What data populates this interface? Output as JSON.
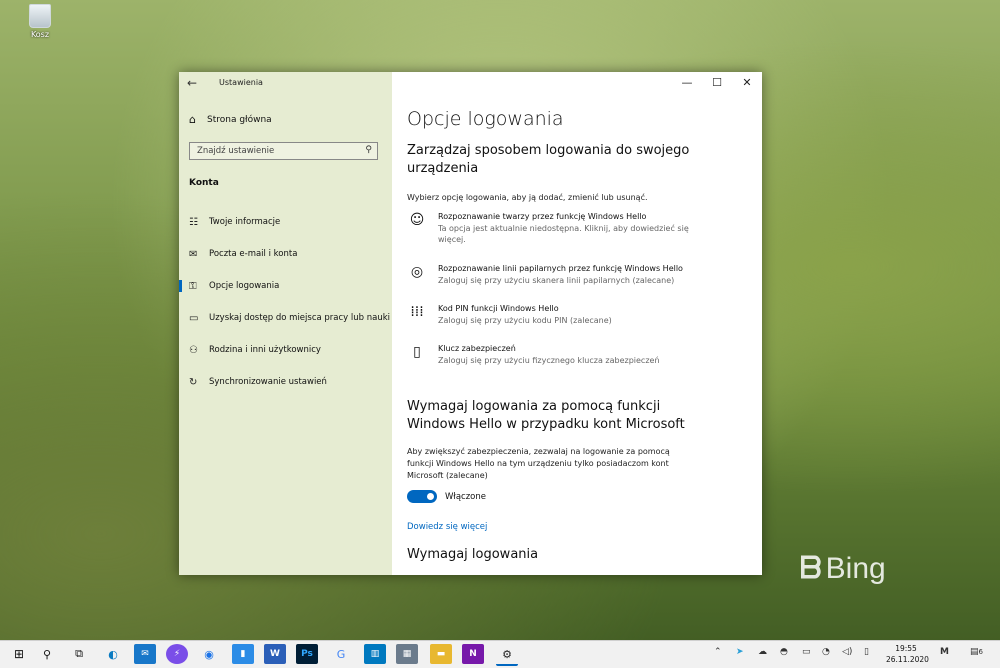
{
  "desktop": {
    "recycle_bin_label": "Kosz",
    "watermark": "Bing"
  },
  "window": {
    "app_title": "Ustawienia",
    "controls": {
      "minimize": "—",
      "maximize": "☐",
      "close": "✕"
    }
  },
  "sidebar": {
    "home_label": "Strona główna",
    "search_placeholder": "Znajdź ustawienie",
    "section": "Konta",
    "items": [
      {
        "label": "Twoje informacje",
        "icon": "person-card-icon"
      },
      {
        "label": "Poczta e-mail i konta",
        "icon": "mail-icon"
      },
      {
        "label": "Opcje logowania",
        "icon": "key-icon"
      },
      {
        "label": "Uzyskaj dostęp do miejsca pracy lub nauki",
        "icon": "briefcase-icon"
      },
      {
        "label": "Rodzina i inni użytkownicy",
        "icon": "people-icon"
      },
      {
        "label": "Synchronizowanie ustawień",
        "icon": "sync-icon"
      }
    ]
  },
  "content": {
    "title": "Opcje logowania",
    "manage_heading": "Zarządzaj sposobem logowania do swojego urządzenia",
    "manage_desc": "Wybierz opcję logowania, aby ją dodać, zmienić lub usunąć.",
    "options": [
      {
        "title": "Rozpoznawanie twarzy przez funkcję Windows Hello",
        "sub": "Ta opcja jest aktualnie niedostępna. Kliknij, aby dowiedzieć się więcej.",
        "icon": "face-icon"
      },
      {
        "title": "Rozpoznawanie linii papilarnych przez funkcję Windows Hello",
        "sub": "Zaloguj się przy użyciu skanera linii papilarnych (zalecane)",
        "icon": "fingerprint-icon"
      },
      {
        "title": "Kod PIN funkcji Windows Hello",
        "sub": "Zaloguj się przy użyciu kodu PIN (zalecane)",
        "icon": "pin-keypad-icon"
      },
      {
        "title": "Klucz zabezpieczeń",
        "sub": "Zaloguj się przy użyciu fizycznego klucza zabezpieczeń",
        "icon": "usb-key-icon"
      }
    ],
    "require_hello_heading": "Wymagaj logowania za pomocą funkcji Windows Hello w przypadku kont Microsoft",
    "require_hello_desc": "Aby zwiększyć zabezpieczenia, zezwalaj na logowanie za pomocą funkcji Windows Hello na tym urządzeniu tylko posiadaczom kont Microsoft (zalecane)",
    "toggle_state": "Włączone",
    "learn_more": "Dowiedz się więcej",
    "require_login_heading": "Wymagaj logowania"
  },
  "taskbar": {
    "time": "19:55",
    "date": "26.11.2020",
    "notification_count": "6",
    "accent": "#0067c0"
  }
}
